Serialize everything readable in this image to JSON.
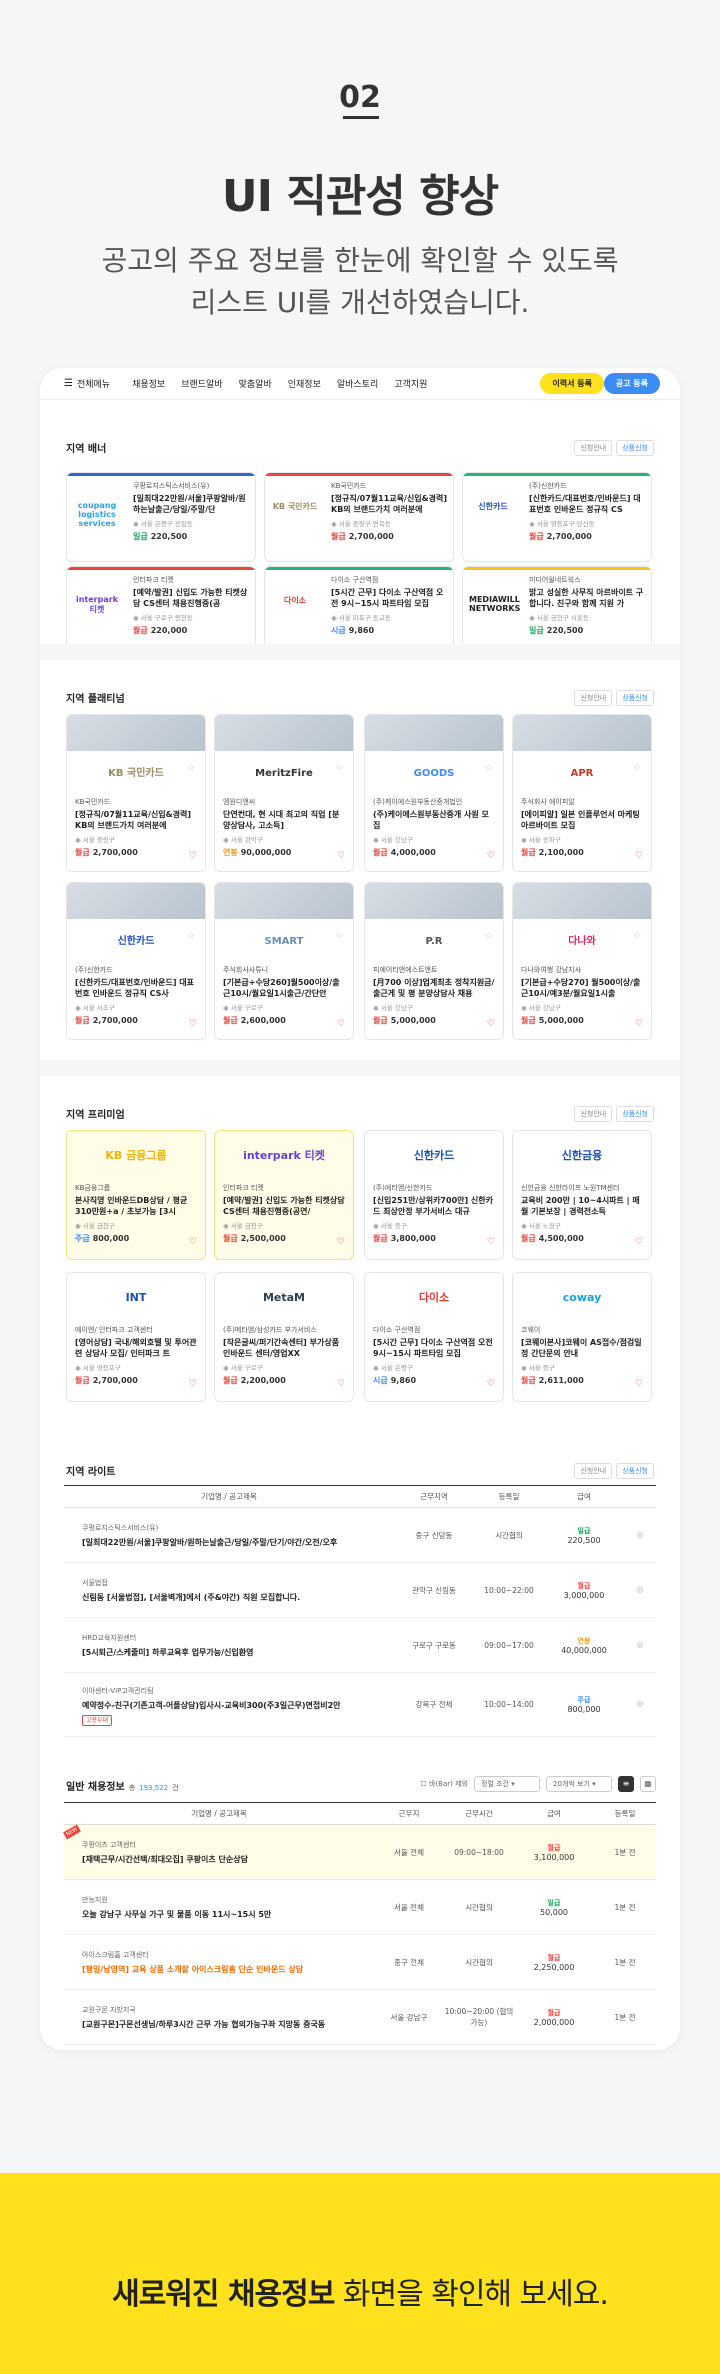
{
  "hero": {
    "number": "02",
    "title": "UI 직관성 향상",
    "subtitle_line1": "공고의 주요 정보를 한눈에 확인할 수 있도록",
    "subtitle_line2": "리스트 UI를 개선하였습니다."
  },
  "topbar": {
    "all_menu": "전체메뉴",
    "nav": [
      "채용정보",
      "브랜드알바",
      "맞춤알바",
      "인재정보",
      "알바스토리",
      "고객지원"
    ],
    "resume_button": "이력서 등록",
    "job_button": "공고 등록"
  },
  "section_buttons": {
    "info": "신청안내",
    "apply": "상품신청"
  },
  "banner": {
    "title": "지역 배너",
    "cards": [
      {
        "logo": "coupang logistics services",
        "logo_color": "#2aa6df",
        "line": "#2f63d6",
        "company": "쿠팡로지스틱스서비스(유)",
        "title": "[일최대22만원/서울]쿠팡알바/원하는날출근/당일/주말/단",
        "loc": "서울 은평구 응암동",
        "tag": "일급",
        "pay": "220,500",
        "tagc": "green"
      },
      {
        "logo": "KB 국민카드",
        "logo_color": "#9b8b61",
        "line": "#e9434c",
        "company": "KB국민카드",
        "title": "[정규직/07월11교육/신입&경력] KB의 브랜드가치 여러분에",
        "loc": "서울 중랑구 면목동",
        "tag": "월급",
        "pay": "2,700,000",
        "tagc": "red"
      },
      {
        "logo": "신한카드",
        "logo_color": "#1f4fb5",
        "line": "#27b37c",
        "company": "(주)신한카드",
        "title": "[신한카드/대표번호/인바운드] 대표번호 인바운드 정규직 CS",
        "loc": "서울 영등포구 당산동",
        "tag": "월급",
        "pay": "2,700,000",
        "tagc": "red"
      },
      {
        "logo": "interpark 티켓",
        "logo_color": "#6b3fd4",
        "line": "#e9434c",
        "company": "인터파크 티켓",
        "title": "[예약/발권] 신입도 가능한 티켓상담 CS센터 채용진행중(공",
        "loc": "서울 구로구 봉천동",
        "tag": "월급",
        "pay": "220,000",
        "tagc": "red"
      },
      {
        "logo": "다이소",
        "logo_color": "#e53935",
        "line": "#27b37c",
        "company": "다이소 구산역점",
        "title": "[5시간 근무] 다이소 구산역점 오전 9시~15시 파트타임 모집",
        "loc": "서울 마포구 동교동",
        "tag": "시급",
        "pay": "9,860",
        "tagc": "blue"
      },
      {
        "logo": "MEDIAWILL NETWORKS",
        "logo_color": "#222222",
        "line": "#f5c518",
        "company": "미디어윌네트웍스",
        "title": "밝고 성실한 사무직 아르바이트 구합니다. 친구와 함께 지원 가",
        "loc": "서울 금천구 시흥동",
        "tag": "일급",
        "pay": "220,500",
        "tagc": "green"
      }
    ]
  },
  "platinum": {
    "title": "지역 플래티넘",
    "cards": [
      {
        "logo": "KB 국민카드",
        "logo_color": "#9b8b61",
        "company": "KB국민카드",
        "title": "[정규직/07월11교육/신입&경력] KB의 브랜드가치 여러분에",
        "loc": "서울 중랑구",
        "tag": "월급",
        "pay": "2,700,000",
        "tagc": "red"
      },
      {
        "logo": "MeritzFire",
        "logo_color": "#333333",
        "company": "엠원디앤씨",
        "title": "단연컨대, 현 시대 최고의 직업 [분양상담사, 고소득]",
        "loc": "서울 관악구",
        "tag": "연봉",
        "pay": "90,000,000",
        "tagc": "orange"
      },
      {
        "logo": "GOODS",
        "logo_color": "#3b8cf6",
        "company": "(주)케이에스원부동산중개법인",
        "title": "(주)케이에스원부동산중개 사원 모집",
        "loc": "서울 강남구",
        "tag": "월급",
        "pay": "4,000,000",
        "tagc": "red"
      },
      {
        "logo": "APR",
        "logo_color": "#c0392b",
        "company": "주식회사 에이피알",
        "title": "[에이피알] 일본 인플루언서 마케팅 아르바이트 모집",
        "loc": "서울 송파구",
        "tag": "월급",
        "pay": "2,100,000",
        "tagc": "red"
      },
      {
        "logo": "신한카드",
        "logo_color": "#1f4fb5",
        "company": "(주)신한카드",
        "title": "[신한카드/대표번호/인바운드] 대표번호 인바운드 정규직 CS사",
        "loc": "서울 서초구",
        "tag": "월급",
        "pay": "2,700,000",
        "tagc": "red"
      },
      {
        "logo": "SMART",
        "logo_color": "#6b8fb5",
        "company": "주식회사사튜니",
        "title": "[기본급+수당260]월500이상/출근10시/월요일1시출근/간단안",
        "loc": "서울 구로구",
        "tag": "월급",
        "pay": "2,600,000",
        "tagc": "red"
      },
      {
        "logo": "P.R",
        "logo_color": "#555555",
        "company": "피에이티앤에스트앤트",
        "title": "[月700 이상]업계최초 정착지원금/출근게 및 평 분양상담사 채용",
        "loc": "서울 강남구",
        "tag": "월급",
        "pay": "5,000,000",
        "tagc": "red"
      },
      {
        "logo": "다나와",
        "logo_color": "#e91e63",
        "company": "다나와여행 강남지사",
        "title": "[기본급+수당270] 월500이상/출근10시/예3분/월요일1시출",
        "loc": "서울 강남구",
        "tag": "월급",
        "pay": "5,000,000",
        "tagc": "red"
      }
    ]
  },
  "premium": {
    "title": "지역 프리미엄",
    "cards": [
      {
        "logo": "KB 금융그룹",
        "logo_color": "#f2b400",
        "company": "KB금융그룹",
        "title": "본사직영 인바운드DB상담 / 평균310만원+a / 초보가능 [3시",
        "loc": "서울 금천구",
        "tag": "주급",
        "pay": "800,000",
        "tagc": "blue",
        "yellow": true
      },
      {
        "logo": "interpark 티켓",
        "logo_color": "#6b3fd4",
        "company": "인터파크 티켓",
        "title": "[예약/발권] 신입도 가능한 티켓상담 CS센터 채용진행중(공연/",
        "loc": "서울 금천구",
        "tag": "월급",
        "pay": "2,500,000",
        "tagc": "red",
        "yellow": true
      },
      {
        "logo": "신한카드",
        "logo_color": "#1f4fb5",
        "company": "(주)에티엠/신한카드",
        "title": "[신입251만/상위카700만] 신한카드 최상안정 부가서비스 대규",
        "loc": "서울 중구",
        "tag": "월급",
        "pay": "3,800,000",
        "tagc": "red",
        "yellow": false
      },
      {
        "logo": "신한금융",
        "logo_color": "#1f4fb5",
        "company": "신한금융 신한라이프 노원TM센터",
        "title": "교육비 200만 | 10~4시파트 | 매월 기본보장 | 경력전소득",
        "loc": "서울 노원구",
        "tag": "월급",
        "pay": "4,500,000",
        "tagc": "red",
        "yellow": false
      },
      {
        "logo": "INT",
        "logo_color": "#1f4fb5",
        "company": "에이엔/ 인터파크 고객센터",
        "title": "[영어상담] 국내/해외호텔 및 투어관련 상담사 모집/ 인터파크 트",
        "loc": "서울 영등포구",
        "tag": "월급",
        "pay": "2,700,000",
        "tagc": "red",
        "yellow": false
      },
      {
        "logo": "MetaM",
        "logo_color": "#2c3e50",
        "company": "(주)메타엠/삼성카드 부가서비스",
        "title": "[작은글씨/퍼기간속센터] 부가상품 인바운드 센터/영업XX",
        "loc": "서울 구로구",
        "tag": "월급",
        "pay": "2,200,000",
        "tagc": "red",
        "yellow": false
      },
      {
        "logo": "다이소",
        "logo_color": "#e53935",
        "company": "다이소 구산역점",
        "title": "[5시간 근무] 다이소 구산역점 오전 9시~15시 파트타임 모집",
        "loc": "서울 은평구",
        "tag": "시급",
        "pay": "9,860",
        "tagc": "blue",
        "yellow": false
      },
      {
        "logo": "coway",
        "logo_color": "#1aa3d8",
        "company": "코웨이",
        "title": "[코웨이본사]코웨이 AS접수/점검일정 간단문의 안내",
        "loc": "서울 중구",
        "tag": "월급",
        "pay": "2,611,000",
        "tagc": "red",
        "yellow": false
      }
    ]
  },
  "lite": {
    "title": "지역 라이트",
    "columns": [
      "기업명 / 공고제목",
      "근무지역",
      "등록일",
      "급여"
    ],
    "rows": [
      {
        "company": "쿠팡로지스틱스서비스(유)",
        "title": "[일최대22만원/서울]쿠팡알바/원하는날출근/당일/주말/단기/야간/오전/오후",
        "area": "중구 신당동",
        "date": "시간협의",
        "tag": "일급",
        "tagc": "green",
        "pay": "220,500",
        "orange": false
      },
      {
        "company": "서울법접",
        "title": "신림동 [서울법접], [서울벽개]에서 (주&야간) 직원 모집합니다.",
        "area": "관악구 신림동",
        "date": "10:00~22:00",
        "tag": "월급",
        "tagc": "red",
        "pay": "3,000,000",
        "orange": false
      },
      {
        "company": "HRD교육지원센터",
        "title": "[5시퇴근/스케줄미] 하루교육후 업무가능/신입환영",
        "area": "구로구 구로동",
        "date": "09:00~17:00",
        "tag": "연봉",
        "tagc": "orange",
        "pay": "40,000,000",
        "orange": false
      },
      {
        "company": "이아센터-VIP고객관리팀",
        "title": "예약정수-친구(기존고객-어플상담)입사시-교육비300(주3일근무)면접비2만",
        "area": "강북구 전체",
        "date": "10:00~14:00",
        "tag": "주급",
        "tagc": "blue",
        "pay": "800,000",
        "orange": false
      }
    ],
    "badge": "고용우대"
  },
  "general": {
    "title": "일반 채용정보",
    "count_label": "총",
    "count": "193,522",
    "count_unit": "건",
    "filter_label": "바(Bar) 제외",
    "sort": "정렬 조건",
    "per_page": "20개씩 보기",
    "columns": [
      "기업명 / 공고제목",
      "근무지",
      "근무시간",
      "급여",
      "등록일"
    ],
    "new_badge": "NEW",
    "rows": [
      {
        "company": "쿠팡이츠 고객센터",
        "title": "[재택근무/시간선택/최대오집] 쿠팡이츠 단순상담",
        "area": "서울 전체",
        "time": "09:00~18:00",
        "tag": "월급",
        "tagc": "red",
        "pay": "3,100,000",
        "date": "1분 전",
        "orange": false
      },
      {
        "company": "만능지원",
        "title": "오늘 강남구 사무실 가구 및 물품 이동 11시~15시 5만",
        "area": "서울 전체",
        "time": "시간협의",
        "tag": "일급",
        "tagc": "green",
        "pay": "50,000",
        "date": "1분 전",
        "orange": false
      },
      {
        "company": "아이스크림홈 고객센터",
        "title": "[평일/남영역] 교육 상품 소개할 아이스크림홈 단순 인바운드 상담",
        "area": "중구 전체",
        "time": "시간협의",
        "tag": "월급",
        "tagc": "red",
        "pay": "2,250,000",
        "date": "1분 전",
        "orange": true
      },
      {
        "company": "교원구몬 지방지국",
        "title": "[교원구몬]구몬선생님/하루3시간 근무 가능 협의가능구좌 지망동 중국동",
        "area": "서울 강남구",
        "time": "10:00~20:00 (협의가능)",
        "tag": "월급",
        "tagc": "red",
        "pay": "2,000,000",
        "date": "1분 전",
        "orange": false
      }
    ]
  },
  "cta": {
    "bold": "새로워진 채용정보",
    "rest": " 화면을 확인해 보세요."
  },
  "colors": {
    "accent_yellow": "#ffe11e",
    "accent_blue": "#3b8cf6",
    "pay_red": "#f0433e",
    "pay_green": "#1aa260"
  }
}
